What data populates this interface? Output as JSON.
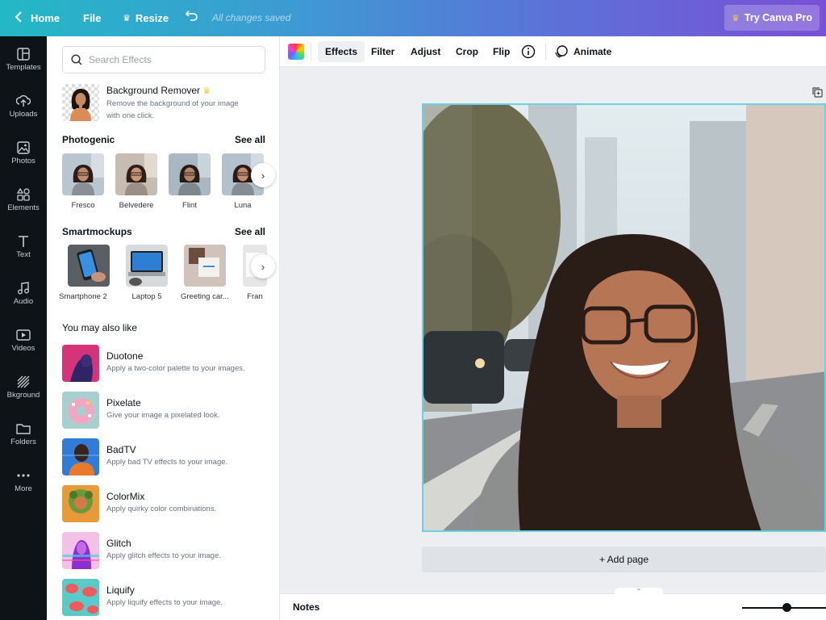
{
  "topbar": {
    "home": "Home",
    "file": "File",
    "resize": "Resize",
    "saved": "All changes saved",
    "try_pro": "Try Canva Pro"
  },
  "rail": [
    {
      "label": "Templates",
      "icon": "templates-icon"
    },
    {
      "label": "Uploads",
      "icon": "uploads-icon"
    },
    {
      "label": "Photos",
      "icon": "photos-icon"
    },
    {
      "label": "Elements",
      "icon": "elements-icon"
    },
    {
      "label": "Text",
      "icon": "text-icon"
    },
    {
      "label": "Audio",
      "icon": "audio-icon"
    },
    {
      "label": "Videos",
      "icon": "videos-icon"
    },
    {
      "label": "Bkground",
      "icon": "background-icon"
    },
    {
      "label": "Folders",
      "icon": "folders-icon"
    },
    {
      "label": "More",
      "icon": "more-icon"
    }
  ],
  "panel": {
    "search_placeholder": "Search Effects",
    "bg_remover": {
      "title": "Background Remover",
      "desc1": "Remove the background of your image",
      "desc2": "with one click."
    },
    "photogenic": {
      "title": "Photogenic",
      "see_all": "See all",
      "items": [
        "Fresco",
        "Belvedere",
        "Flint",
        "Luna"
      ]
    },
    "smartmockups": {
      "title": "Smartmockups",
      "see_all": "See all",
      "items": [
        "Smartphone 2",
        "Laptop 5",
        "Greeting car...",
        "Fran"
      ]
    },
    "also_like": {
      "title": "You may also like",
      "items": [
        {
          "name": "Duotone",
          "desc": "Apply a two-color palette to your images."
        },
        {
          "name": "Pixelate",
          "desc": "Give your image a pixelated look."
        },
        {
          "name": "BadTV",
          "desc": "Apply bad TV effects to your image."
        },
        {
          "name": "ColorMix",
          "desc": "Apply quirky color combinations."
        },
        {
          "name": "Glitch",
          "desc": "Apply glitch effects to your image."
        },
        {
          "name": "Liquify",
          "desc": "Apply liquify effects to your image."
        }
      ]
    }
  },
  "toolbar": {
    "effects": "Effects",
    "filter": "Filter",
    "adjust": "Adjust",
    "crop": "Crop",
    "flip": "Flip",
    "animate": "Animate"
  },
  "canvas": {
    "add_page": "+ Add page"
  },
  "notes": {
    "label": "Notes",
    "zoom_level": 0.5
  },
  "colors": {
    "accent": "#6ad2de",
    "rail_bg": "#0e1318",
    "crown": "#f5c542"
  }
}
